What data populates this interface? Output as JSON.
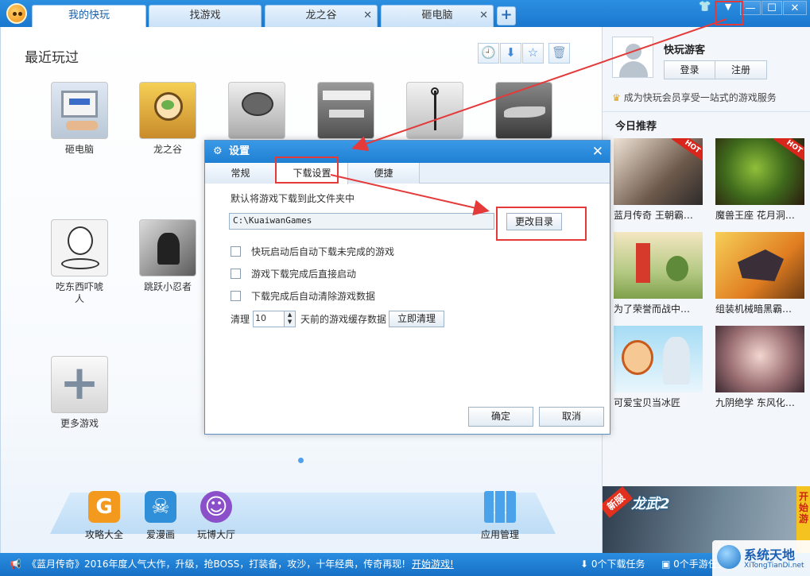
{
  "header": {
    "tabs": [
      {
        "label": "我的快玩",
        "closable": false
      },
      {
        "label": "找游戏",
        "closable": false
      },
      {
        "label": "龙之谷",
        "closable": true
      },
      {
        "label": "砸电脑",
        "closable": true
      }
    ],
    "add_tab": "+",
    "window_buttons": {
      "skin": "👕",
      "menu": "▼",
      "minimize": "—",
      "maximize": "☐",
      "close": "✕"
    },
    "tab_close": "✕"
  },
  "main": {
    "section_title": "最近玩过",
    "toolbar": {
      "history": "🕘",
      "download": "⬇",
      "favorite": "☆",
      "trash": "🗑"
    },
    "games": [
      {
        "label": "砸电脑"
      },
      {
        "label": "龙之谷"
      },
      {
        "label": ""
      },
      {
        "label": ""
      },
      {
        "label": ""
      },
      {
        "label": ""
      },
      {
        "label": "吃东西吓唬\n人"
      },
      {
        "label": "跳跃小忍者"
      }
    ],
    "more_games": {
      "label": "更多游戏",
      "icon": "+"
    },
    "dock": [
      {
        "label": "攻略大全",
        "icon": "G"
      },
      {
        "label": "爱漫画",
        "icon": "☠"
      },
      {
        "label": "玩博大厅",
        "icon": "☺"
      },
      {
        "label": "应用管理",
        "icon": ""
      }
    ]
  },
  "sidebar": {
    "guest_name": "快玩游客",
    "login_label": "登录",
    "register_label": "注册",
    "vip_text": "成为快玩会员享受一站式的游戏服务",
    "today_title": "今日推荐",
    "hot_badge": "HOT",
    "recommendations": [
      {
        "label": "蓝月传奇  王朝霸…"
      },
      {
        "label": "魔兽王座  花月洞…"
      },
      {
        "label": "为了荣誉而战中…"
      },
      {
        "label": "组装机械暗黑霸…"
      },
      {
        "label": "可爱宝贝当冰匠"
      },
      {
        "label": "九阴绝学  东风化…"
      }
    ],
    "banner": {
      "new_tag": "新服",
      "title": "龙武2",
      "side_text": "开始游"
    }
  },
  "statusbar": {
    "speaker": "📢",
    "news": "《蓝月传奇》2016年度人气大作，升级，抢BOSS，打装备，攻沙，十年经典，传奇再现!",
    "start_link": "开始游戏!",
    "downloads": "0个下载任务",
    "mobile": "0个手游任务"
  },
  "watermark": {
    "title": "系统天地",
    "url": "XiTongTianDi.net"
  },
  "dialog": {
    "title": "设置",
    "gear": "⚙",
    "close": "✕",
    "tabs": [
      "常规",
      "下载设置",
      "便捷"
    ],
    "folder_label": "默认将游戏下载到此文件夹中",
    "path_value": "C:\\KuaiwanGames",
    "change_dir": "更改目录",
    "options": [
      "快玩启动后自动下载未完成的游戏",
      "游戏下载完成后直接启动",
      "下载完成后自动清除游戏数据"
    ],
    "clean_prefix": "清理",
    "clean_days": "10",
    "clean_suffix": "天前的游戏缓存数据",
    "clean_now": "立即清理",
    "ok": "确定",
    "cancel": "取消"
  },
  "colors": {
    "accent": "#1f7fd3",
    "annotation": "#e43a3a"
  }
}
